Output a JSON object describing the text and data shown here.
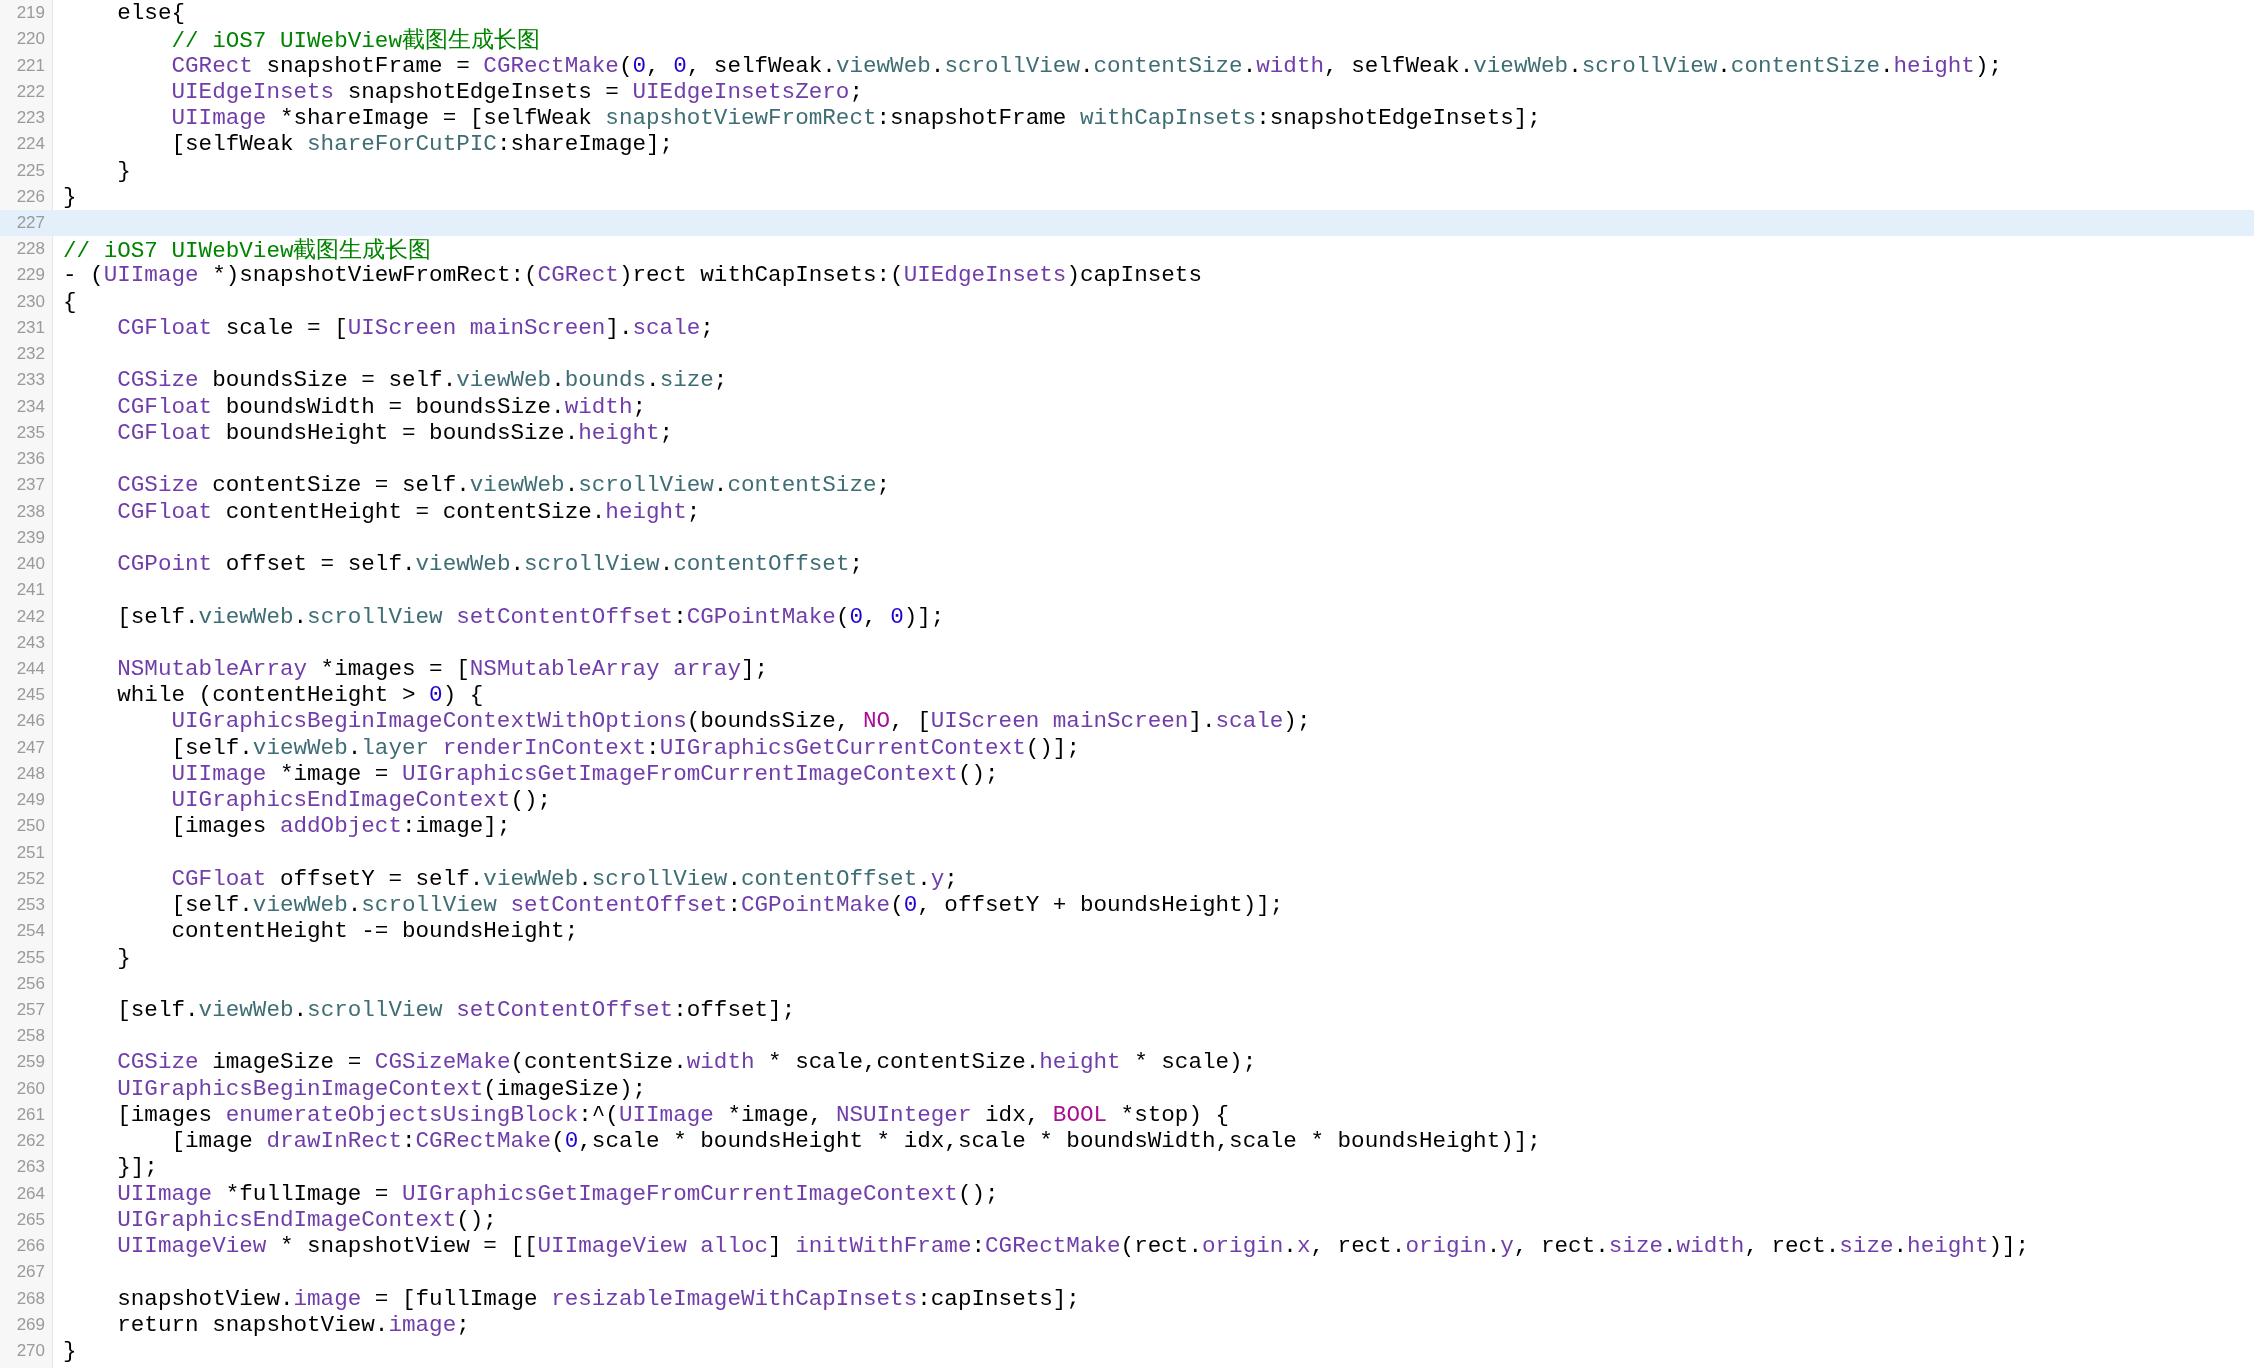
{
  "lines": [
    {
      "number": "219",
      "current": false,
      "tokens": [
        {
          "text": "    else{",
          "kind": "plain"
        }
      ]
    },
    {
      "number": "220",
      "current": false,
      "tokens": [
        {
          "text": "        // iOS7 UIWebView截图生成长图",
          "kind": "comment"
        }
      ]
    },
    {
      "number": "221",
      "current": false,
      "tokens": [
        {
          "text": "        CGRect",
          "kind": "type"
        },
        {
          "text": " snapshotFrame = ",
          "kind": "plain"
        },
        {
          "text": "CGRectMake",
          "kind": "type"
        },
        {
          "text": "(",
          "kind": "plain"
        },
        {
          "text": "0",
          "kind": "number"
        },
        {
          "text": ", ",
          "kind": "plain"
        },
        {
          "text": "0",
          "kind": "number"
        },
        {
          "text": ", selfWeak.",
          "kind": "plain"
        },
        {
          "text": "viewWeb",
          "kind": "project"
        },
        {
          "text": ".",
          "kind": "plain"
        },
        {
          "text": "scrollView",
          "kind": "project"
        },
        {
          "text": ".",
          "kind": "plain"
        },
        {
          "text": "contentSize",
          "kind": "project"
        },
        {
          "text": ".",
          "kind": "plain"
        },
        {
          "text": "width",
          "kind": "type"
        },
        {
          "text": ", selfWeak.",
          "kind": "plain"
        },
        {
          "text": "viewWeb",
          "kind": "project"
        },
        {
          "text": ".",
          "kind": "plain"
        },
        {
          "text": "scrollView",
          "kind": "project"
        },
        {
          "text": ".",
          "kind": "plain"
        },
        {
          "text": "contentSize",
          "kind": "project"
        },
        {
          "text": ".",
          "kind": "plain"
        },
        {
          "text": "height",
          "kind": "type"
        },
        {
          "text": ");",
          "kind": "plain"
        }
      ]
    },
    {
      "number": "222",
      "current": false,
      "tokens": [
        {
          "text": "        UIEdgeInsets",
          "kind": "type"
        },
        {
          "text": " snapshotEdgeInsets = ",
          "kind": "plain"
        },
        {
          "text": "UIEdgeInsetsZero",
          "kind": "type"
        },
        {
          "text": ";",
          "kind": "plain"
        }
      ]
    },
    {
      "number": "223",
      "current": false,
      "tokens": [
        {
          "text": "        UIImage",
          "kind": "type"
        },
        {
          "text": " *shareImage = [selfWeak ",
          "kind": "plain"
        },
        {
          "text": "snapshotViewFromRect",
          "kind": "project"
        },
        {
          "text": ":snapshotFrame ",
          "kind": "plain"
        },
        {
          "text": "withCapInsets",
          "kind": "project"
        },
        {
          "text": ":snapshotEdgeInsets];",
          "kind": "plain"
        }
      ]
    },
    {
      "number": "224",
      "current": false,
      "tokens": [
        {
          "text": "        [selfWeak ",
          "kind": "plain"
        },
        {
          "text": "shareForCutPIC",
          "kind": "project"
        },
        {
          "text": ":shareImage];",
          "kind": "plain"
        }
      ]
    },
    {
      "number": "225",
      "current": false,
      "tokens": [
        {
          "text": "    }",
          "kind": "plain"
        }
      ]
    },
    {
      "number": "226",
      "current": false,
      "tokens": [
        {
          "text": "}",
          "kind": "plain"
        }
      ]
    },
    {
      "number": "227",
      "current": true
    },
    {
      "number": "228",
      "current": false,
      "tokens": [
        {
          "text": "// iOS7 UIWebView截图生成长图",
          "kind": "comment"
        }
      ]
    },
    {
      "number": "229",
      "current": false,
      "tokens": [
        {
          "text": "- (",
          "kind": "plain"
        },
        {
          "text": "UIImage",
          "kind": "type"
        },
        {
          "text": " *)snapshotViewFromRect:(",
          "kind": "plain"
        },
        {
          "text": "CGRect",
          "kind": "type"
        },
        {
          "text": ")rect withCapInsets:(",
          "kind": "plain"
        },
        {
          "text": "UIEdgeInsets",
          "kind": "type"
        },
        {
          "text": ")capInsets",
          "kind": "plain"
        }
      ]
    },
    {
      "number": "230",
      "current": false,
      "tokens": [
        {
          "text": "{",
          "kind": "plain"
        }
      ]
    },
    {
      "number": "231",
      "current": false,
      "tokens": [
        {
          "text": "    CGFloat",
          "kind": "type"
        },
        {
          "text": " scale = [",
          "kind": "plain"
        },
        {
          "text": "UIScreen mainScreen",
          "kind": "type"
        },
        {
          "text": "].",
          "kind": "plain"
        },
        {
          "text": "scale",
          "kind": "type"
        },
        {
          "text": ";",
          "kind": "plain"
        }
      ]
    },
    {
      "number": "232",
      "current": false
    },
    {
      "number": "233",
      "current": false,
      "tokens": [
        {
          "text": "    CGSize",
          "kind": "type"
        },
        {
          "text": " boundsSize = self.",
          "kind": "plain"
        },
        {
          "text": "viewWeb",
          "kind": "project"
        },
        {
          "text": ".",
          "kind": "plain"
        },
        {
          "text": "bounds",
          "kind": "project"
        },
        {
          "text": ".",
          "kind": "plain"
        },
        {
          "text": "size",
          "kind": "project"
        },
        {
          "text": ";",
          "kind": "plain"
        }
      ]
    },
    {
      "number": "234",
      "current": false,
      "tokens": [
        {
          "text": "    CGFloat",
          "kind": "type"
        },
        {
          "text": " boundsWidth = boundsSize.",
          "kind": "plain"
        },
        {
          "text": "width",
          "kind": "type"
        },
        {
          "text": ";",
          "kind": "plain"
        }
      ]
    },
    {
      "number": "235",
      "current": false,
      "tokens": [
        {
          "text": "    CGFloat",
          "kind": "type"
        },
        {
          "text": " boundsHeight = boundsSize.",
          "kind": "plain"
        },
        {
          "text": "height",
          "kind": "type"
        },
        {
          "text": ";",
          "kind": "plain"
        }
      ]
    },
    {
      "number": "236",
      "current": false
    },
    {
      "number": "237",
      "current": false,
      "tokens": [
        {
          "text": "    CGSize",
          "kind": "type"
        },
        {
          "text": " contentSize = self.",
          "kind": "plain"
        },
        {
          "text": "viewWeb",
          "kind": "project"
        },
        {
          "text": ".",
          "kind": "plain"
        },
        {
          "text": "scrollView",
          "kind": "project"
        },
        {
          "text": ".",
          "kind": "plain"
        },
        {
          "text": "contentSize",
          "kind": "project"
        },
        {
          "text": ";",
          "kind": "plain"
        }
      ]
    },
    {
      "number": "238",
      "current": false,
      "tokens": [
        {
          "text": "    CGFloat",
          "kind": "type"
        },
        {
          "text": " contentHeight = contentSize.",
          "kind": "plain"
        },
        {
          "text": "height",
          "kind": "type"
        },
        {
          "text": ";",
          "kind": "plain"
        }
      ]
    },
    {
      "number": "239",
      "current": false
    },
    {
      "number": "240",
      "current": false,
      "tokens": [
        {
          "text": "    CGPoint",
          "kind": "type"
        },
        {
          "text": " offset = self.",
          "kind": "plain"
        },
        {
          "text": "viewWeb",
          "kind": "project"
        },
        {
          "text": ".",
          "kind": "plain"
        },
        {
          "text": "scrollView",
          "kind": "project"
        },
        {
          "text": ".",
          "kind": "plain"
        },
        {
          "text": "contentOffset",
          "kind": "project"
        },
        {
          "text": ";",
          "kind": "plain"
        }
      ]
    },
    {
      "number": "241",
      "current": false
    },
    {
      "number": "242",
      "current": false,
      "tokens": [
        {
          "text": "    [self.",
          "kind": "plain"
        },
        {
          "text": "viewWeb",
          "kind": "project"
        },
        {
          "text": ".",
          "kind": "plain"
        },
        {
          "text": "scrollView ",
          "kind": "project"
        },
        {
          "text": "setContentOffset",
          "kind": "type"
        },
        {
          "text": ":",
          "kind": "plain"
        },
        {
          "text": "CGPointMake",
          "kind": "type"
        },
        {
          "text": "(",
          "kind": "plain"
        },
        {
          "text": "0",
          "kind": "number"
        },
        {
          "text": ", ",
          "kind": "plain"
        },
        {
          "text": "0",
          "kind": "number"
        },
        {
          "text": ")];",
          "kind": "plain"
        }
      ]
    },
    {
      "number": "243",
      "current": false
    },
    {
      "number": "244",
      "current": false,
      "tokens": [
        {
          "text": "    NSMutableArray",
          "kind": "type"
        },
        {
          "text": " *images = [",
          "kind": "plain"
        },
        {
          "text": "NSMutableArray array",
          "kind": "type"
        },
        {
          "text": "];",
          "kind": "plain"
        }
      ]
    },
    {
      "number": "245",
      "current": false,
      "tokens": [
        {
          "text": "    while (contentHeight > ",
          "kind": "plain"
        },
        {
          "text": "0",
          "kind": "number"
        },
        {
          "text": ") {",
          "kind": "plain"
        }
      ]
    },
    {
      "number": "246",
      "current": false,
      "tokens": [
        {
          "text": "        UIGraphicsBeginImageContextWithOptions",
          "kind": "type"
        },
        {
          "text": "(boundsSize, ",
          "kind": "plain"
        },
        {
          "text": "NO",
          "kind": "keyword"
        },
        {
          "text": ", [",
          "kind": "plain"
        },
        {
          "text": "UIScreen mainScreen",
          "kind": "type"
        },
        {
          "text": "].",
          "kind": "plain"
        },
        {
          "text": "scale",
          "kind": "type"
        },
        {
          "text": ");",
          "kind": "plain"
        }
      ]
    },
    {
      "number": "247",
      "current": false,
      "tokens": [
        {
          "text": "        [self.",
          "kind": "plain"
        },
        {
          "text": "viewWeb",
          "kind": "project"
        },
        {
          "text": ".",
          "kind": "plain"
        },
        {
          "text": "layer ",
          "kind": "project"
        },
        {
          "text": "renderInContext",
          "kind": "type"
        },
        {
          "text": ":",
          "kind": "plain"
        },
        {
          "text": "UIGraphicsGetCurrentContext",
          "kind": "type"
        },
        {
          "text": "()];",
          "kind": "plain"
        }
      ]
    },
    {
      "number": "248",
      "current": false,
      "tokens": [
        {
          "text": "        UIImage",
          "kind": "type"
        },
        {
          "text": " *image = ",
          "kind": "plain"
        },
        {
          "text": "UIGraphicsGetImageFromCurrentImageContext",
          "kind": "type"
        },
        {
          "text": "();",
          "kind": "plain"
        }
      ]
    },
    {
      "number": "249",
      "current": false,
      "tokens": [
        {
          "text": "        UIGraphicsEndImageContext",
          "kind": "type"
        },
        {
          "text": "();",
          "kind": "plain"
        }
      ]
    },
    {
      "number": "250",
      "current": false,
      "tokens": [
        {
          "text": "        [images ",
          "kind": "plain"
        },
        {
          "text": "addObject",
          "kind": "type"
        },
        {
          "text": ":image];",
          "kind": "plain"
        }
      ]
    },
    {
      "number": "251",
      "current": false
    },
    {
      "number": "252",
      "current": false,
      "tokens": [
        {
          "text": "        CGFloat",
          "kind": "type"
        },
        {
          "text": " offsetY = self.",
          "kind": "plain"
        },
        {
          "text": "viewWeb",
          "kind": "project"
        },
        {
          "text": ".",
          "kind": "plain"
        },
        {
          "text": "scrollView",
          "kind": "project"
        },
        {
          "text": ".",
          "kind": "plain"
        },
        {
          "text": "contentOffset",
          "kind": "project"
        },
        {
          "text": ".",
          "kind": "plain"
        },
        {
          "text": "y",
          "kind": "type"
        },
        {
          "text": ";",
          "kind": "plain"
        }
      ]
    },
    {
      "number": "253",
      "current": false,
      "tokens": [
        {
          "text": "        [self.",
          "kind": "plain"
        },
        {
          "text": "viewWeb",
          "kind": "project"
        },
        {
          "text": ".",
          "kind": "plain"
        },
        {
          "text": "scrollView ",
          "kind": "project"
        },
        {
          "text": "setContentOffset",
          "kind": "type"
        },
        {
          "text": ":",
          "kind": "plain"
        },
        {
          "text": "CGPointMake",
          "kind": "type"
        },
        {
          "text": "(",
          "kind": "plain"
        },
        {
          "text": "0",
          "kind": "number"
        },
        {
          "text": ", offsetY + boundsHeight)];",
          "kind": "plain"
        }
      ]
    },
    {
      "number": "254",
      "current": false,
      "tokens": [
        {
          "text": "        contentHeight -= boundsHeight;",
          "kind": "plain"
        }
      ]
    },
    {
      "number": "255",
      "current": false,
      "tokens": [
        {
          "text": "    }",
          "kind": "plain"
        }
      ]
    },
    {
      "number": "256",
      "current": false
    },
    {
      "number": "257",
      "current": false,
      "tokens": [
        {
          "text": "    [self.",
          "kind": "plain"
        },
        {
          "text": "viewWeb",
          "kind": "project"
        },
        {
          "text": ".",
          "kind": "plain"
        },
        {
          "text": "scrollView ",
          "kind": "project"
        },
        {
          "text": "setContentOffset",
          "kind": "type"
        },
        {
          "text": ":offset];",
          "kind": "plain"
        }
      ]
    },
    {
      "number": "258",
      "current": false
    },
    {
      "number": "259",
      "current": false,
      "tokens": [
        {
          "text": "    CGSize",
          "kind": "type"
        },
        {
          "text": " imageSize = ",
          "kind": "plain"
        },
        {
          "text": "CGSizeMake",
          "kind": "type"
        },
        {
          "text": "(contentSize.",
          "kind": "plain"
        },
        {
          "text": "width",
          "kind": "type"
        },
        {
          "text": " * scale,contentSize.",
          "kind": "plain"
        },
        {
          "text": "height",
          "kind": "type"
        },
        {
          "text": " * scale);",
          "kind": "plain"
        }
      ]
    },
    {
      "number": "260",
      "current": false,
      "tokens": [
        {
          "text": "    UIGraphicsBeginImageContext",
          "kind": "type"
        },
        {
          "text": "(imageSize);",
          "kind": "plain"
        }
      ]
    },
    {
      "number": "261",
      "current": false,
      "tokens": [
        {
          "text": "    [images ",
          "kind": "plain"
        },
        {
          "text": "enumerateObjectsUsingBlock",
          "kind": "type"
        },
        {
          "text": ":^(",
          "kind": "plain"
        },
        {
          "text": "UIImage",
          "kind": "type"
        },
        {
          "text": " *image, ",
          "kind": "plain"
        },
        {
          "text": "NSUInteger",
          "kind": "type"
        },
        {
          "text": " idx, ",
          "kind": "plain"
        },
        {
          "text": "BOOL",
          "kind": "keyword"
        },
        {
          "text": " *stop) {",
          "kind": "plain"
        }
      ]
    },
    {
      "number": "262",
      "current": false,
      "tokens": [
        {
          "text": "        [image ",
          "kind": "plain"
        },
        {
          "text": "drawInRect",
          "kind": "type"
        },
        {
          "text": ":",
          "kind": "plain"
        },
        {
          "text": "CGRectMake",
          "kind": "type"
        },
        {
          "text": "(",
          "kind": "plain"
        },
        {
          "text": "0",
          "kind": "number"
        },
        {
          "text": ",scale * boundsHeight * idx,scale * boundsWidth,scale * boundsHeight)];",
          "kind": "plain"
        }
      ]
    },
    {
      "number": "263",
      "current": false,
      "tokens": [
        {
          "text": "    }];",
          "kind": "plain"
        }
      ]
    },
    {
      "number": "264",
      "current": false,
      "tokens": [
        {
          "text": "    UIImage",
          "kind": "type"
        },
        {
          "text": " *fullImage = ",
          "kind": "plain"
        },
        {
          "text": "UIGraphicsGetImageFromCurrentImageContext",
          "kind": "type"
        },
        {
          "text": "();",
          "kind": "plain"
        }
      ]
    },
    {
      "number": "265",
      "current": false,
      "tokens": [
        {
          "text": "    UIGraphicsEndImageContext",
          "kind": "type"
        },
        {
          "text": "();",
          "kind": "plain"
        }
      ]
    },
    {
      "number": "266",
      "current": false,
      "tokens": [
        {
          "text": "    UIImageView",
          "kind": "type"
        },
        {
          "text": " * snapshotView = [[",
          "kind": "plain"
        },
        {
          "text": "UIImageView alloc",
          "kind": "type"
        },
        {
          "text": "] ",
          "kind": "plain"
        },
        {
          "text": "initWithFrame",
          "kind": "type"
        },
        {
          "text": ":",
          "kind": "plain"
        },
        {
          "text": "CGRectMake",
          "kind": "type"
        },
        {
          "text": "(rect.",
          "kind": "plain"
        },
        {
          "text": "origin",
          "kind": "type"
        },
        {
          "text": ".",
          "kind": "plain"
        },
        {
          "text": "x",
          "kind": "type"
        },
        {
          "text": ", rect.",
          "kind": "plain"
        },
        {
          "text": "origin",
          "kind": "type"
        },
        {
          "text": ".",
          "kind": "plain"
        },
        {
          "text": "y",
          "kind": "type"
        },
        {
          "text": ", rect.",
          "kind": "plain"
        },
        {
          "text": "size",
          "kind": "type"
        },
        {
          "text": ".",
          "kind": "plain"
        },
        {
          "text": "width",
          "kind": "type"
        },
        {
          "text": ", rect.",
          "kind": "plain"
        },
        {
          "text": "size",
          "kind": "type"
        },
        {
          "text": ".",
          "kind": "plain"
        },
        {
          "text": "height",
          "kind": "type"
        },
        {
          "text": ")];",
          "kind": "plain"
        }
      ]
    },
    {
      "number": "267",
      "current": false
    },
    {
      "number": "268",
      "current": false,
      "tokens": [
        {
          "text": "    snapshotView.",
          "kind": "plain"
        },
        {
          "text": "image",
          "kind": "type"
        },
        {
          "text": " = [fullImage ",
          "kind": "plain"
        },
        {
          "text": "resizableImageWithCapInsets",
          "kind": "type"
        },
        {
          "text": ":capInsets];",
          "kind": "plain"
        }
      ]
    },
    {
      "number": "269",
      "current": false,
      "tokens": [
        {
          "text": "    return snapshotView.",
          "kind": "plain"
        },
        {
          "text": "image",
          "kind": "type"
        },
        {
          "text": ";",
          "kind": "plain"
        }
      ]
    },
    {
      "number": "270",
      "current": false,
      "tokens": [
        {
          "text": "}",
          "kind": "plain"
        }
      ]
    }
  ]
}
